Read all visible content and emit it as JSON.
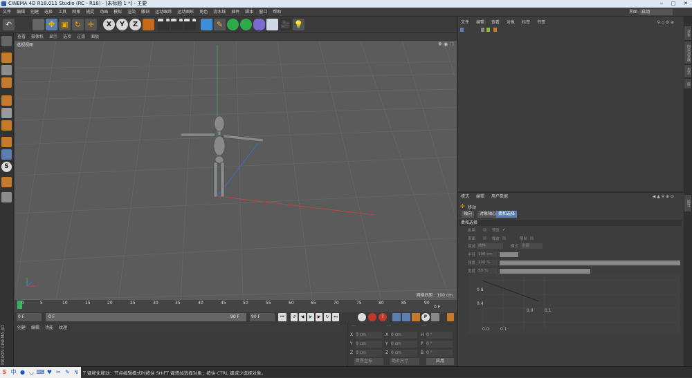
{
  "window": {
    "title": "CINEMA 4D R18.011 Studio (RC - R18) - [未标题 1 *] - 主要"
  },
  "menu": [
    "文件",
    "编辑",
    "创建",
    "选择",
    "工具",
    "网格",
    "捕捉",
    "动画",
    "模拟",
    "渲染",
    "雕刻",
    "运动跟踪",
    "运动图形",
    "角色",
    "流水线",
    "插件",
    "脚本",
    "窗口",
    "帮助"
  ],
  "interface": {
    "label": "界面:",
    "value": "启动"
  },
  "toolbar": {
    "icons": [
      "undo-icon",
      "select-arrow-icon",
      "move-icon",
      "scale-icon",
      "rotate-icon",
      "last-tool-icon",
      "x-axis-icon",
      "y-axis-icon",
      "z-axis-icon",
      "coordinate-system-icon",
      "render-view-icon",
      "render-picture-queue-icon",
      "edit-render-settings-icon",
      "cube-icon",
      "pen-spline-icon",
      "subdivision-icon",
      "array-icon",
      "deformer-icon",
      "floor-icon",
      "camera-icon",
      "light-icon"
    ],
    "axis_labels": [
      "X",
      "Y",
      "Z"
    ]
  },
  "viewport": {
    "menu": [
      "查看",
      "摄像机",
      "显示",
      "选项",
      "过滤",
      "面板"
    ],
    "label": "透视视图",
    "grid_label": "网格间距 : 100 cm"
  },
  "timeline": {
    "ticks": [
      "0",
      "5",
      "10",
      "15",
      "20",
      "25",
      "30",
      "35",
      "40",
      "45",
      "50",
      "55",
      "60",
      "65",
      "70",
      "75",
      "80",
      "85",
      "90"
    ],
    "end_label": "0 F",
    "current_frame": "0 F",
    "start_field": "0 F",
    "end_field": "90 F",
    "max_field": "90 F"
  },
  "material": {
    "menu": [
      "创建",
      "编辑",
      "功能",
      "纹理"
    ]
  },
  "coordinates": {
    "header": [
      "---",
      "---",
      "---"
    ],
    "rows": [
      {
        "axis1": "X",
        "v1": "0 cm",
        "axis2": "X",
        "v2": "0 cm",
        "axis3": "H",
        "v3": "0 °"
      },
      {
        "axis1": "Y",
        "v1": "0 cm",
        "axis2": "Y",
        "v2": "0 cm",
        "axis3": "P",
        "v3": "0 °"
      },
      {
        "axis1": "Z",
        "v1": "0 cm",
        "axis2": "Z",
        "v2": "0 cm",
        "axis3": "B",
        "v3": "0 °"
      }
    ],
    "world_select": "世界坐标",
    "size_select": "绝对尺寸",
    "apply_button": "应用"
  },
  "objects": {
    "menu": [
      "文件",
      "编辑",
      "查看",
      "对象",
      "标签",
      "书签"
    ]
  },
  "attributes": {
    "menu": [
      "模式",
      "编辑",
      "用户数据"
    ],
    "tool_name": "移动",
    "tabs": [
      "轴向",
      "对象轴心",
      "柔和选择"
    ],
    "section": "柔和选择",
    "props": {
      "enable_label": "启用",
      "preview_label": "预览",
      "preview_check": "✓",
      "surface_label": "表面",
      "rubber_label": "橡皮",
      "restrict_label": "限制",
      "mode_label": "衰减",
      "mode_value": "线性",
      "mode2_label": "模式",
      "mode2_value": "全部",
      "radius_label": "半径",
      "radius_value": "100 cm",
      "strength_label": "强度",
      "strength_value": "100 %",
      "width_label": "宽度",
      "width_value": "50 %"
    },
    "graph": {
      "y_labels": [
        "0.8",
        "0.4"
      ],
      "x_labels": [
        "0.0",
        "0.1"
      ],
      "top_labels": [
        "0.0",
        "0.1"
      ]
    }
  },
  "right_strip": [
    "对象",
    "内容浏览器",
    "构造",
    "层"
  ],
  "attr_strip": [
    "属性"
  ],
  "status": {
    "message": "T 键移化移动：节点编辑模式时按住 SHIFT 键增加选择对象；按住 CTRL 键减少选择对象。",
    "ime": [
      "S",
      "中",
      "●",
      "◡",
      "⌨",
      "♥",
      "✂",
      "✎",
      "↯"
    ]
  },
  "colors": {
    "accent_blue": "#5b7fb3",
    "viewport_bg": "#5b5b5b",
    "x_axis": "#c0392b",
    "y_axis": "#27ae60",
    "z_axis": "#2f5fc4"
  }
}
